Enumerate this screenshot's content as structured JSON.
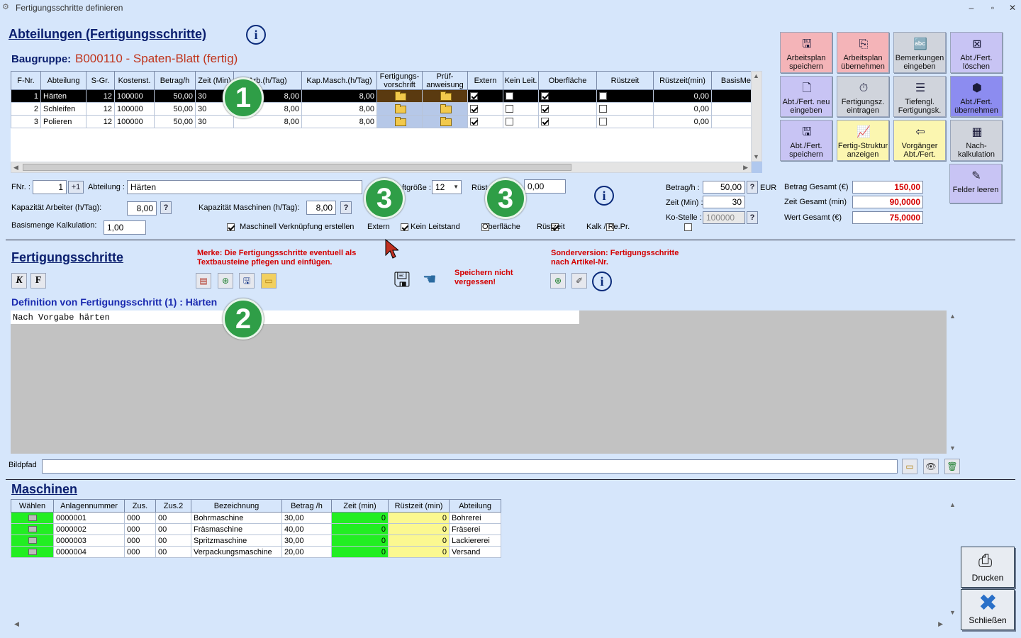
{
  "window": {
    "title": "Fertigungsschritte definieren",
    "min": "–",
    "max": "▫",
    "close": "✕"
  },
  "abteilungen": {
    "title": "Abteilungen (Fertigungsschritte) ",
    "baugruppe_label": "Baugruppe:",
    "baugruppe_value": "B000110 - Spaten-Blatt (fertig)"
  },
  "dept_table": {
    "headers": [
      "F-Nr.",
      "Abteilung",
      "S-Gr.",
      "Kostenst.",
      "Betrag/h",
      "Zeit (Min)",
      "Arb.(h/Tag)",
      "Kap.Masch.(h/Tag)",
      "Fertigungs-vorschrift",
      "Prüf-anweisung",
      "Extern",
      "Kein Leit.",
      "Oberfläche",
      "Rüstzeit",
      "Rüstzeit(min)",
      "BasisMe."
    ],
    "rows": [
      {
        "nr": "1",
        "abteilung": "Härten",
        "sgr": "12",
        "kst": "100000",
        "betrag": "50,00",
        "zeit": "30",
        "arb": "8,00",
        "kap": "8,00",
        "extern": true,
        "keinleit": false,
        "oberflaeche": true,
        "ruestzeit": false,
        "ruestmin": "0,00"
      },
      {
        "nr": "2",
        "abteilung": "Schleifen",
        "sgr": "12",
        "kst": "100000",
        "betrag": "50,00",
        "zeit": "30",
        "arb": "8,00",
        "kap": "8,00",
        "extern": true,
        "keinleit": false,
        "oberflaeche": true,
        "ruestzeit": false,
        "ruestmin": "0,00"
      },
      {
        "nr": "3",
        "abteilung": "Polieren",
        "sgr": "12",
        "kst": "100000",
        "betrag": "50,00",
        "zeit": "30",
        "arb": "8,00",
        "kap": "8,00",
        "extern": true,
        "keinleit": false,
        "oberflaeche": true,
        "ruestzeit": false,
        "ruestmin": "0,00"
      }
    ]
  },
  "form": {
    "fnr_label": "FNr. :",
    "fnr_value": "1",
    "plus1": "+1",
    "abteilung_label": "Abteilung :",
    "abteilung_value": "Härten",
    "losgroesse_label": "ftgröße :",
    "losgroesse_value": "12",
    "ruest_label": "Rüst",
    "ruest_value": "0,00",
    "kap_arb_label": "Kapazität Arbeiter (h/Tag):",
    "kap_arb_value": "8,00",
    "kap_masch_label": "Kapazität Maschinen (h/Tag):",
    "kap_masch_value": "8,00",
    "basis_label": "Basismenge Kalkulation:",
    "basis_value": "1,00",
    "maschinell_label": "Maschinell Verknüpfung erstellen",
    "extern_label": "Extern",
    "keinleit_label": "Kein Leitstand",
    "oberflaeche_label": "Oberfläche",
    "ruestzeit_label": "Rüstzeit",
    "kalk_label": "Kalk / Re.Pr.",
    "q": "?",
    "betrag_label": "Betrag/h :",
    "betrag_value": "50,00",
    "eur": "EUR",
    "zeit_label": "Zeit (Min) :",
    "zeit_value": "30",
    "kostelle_label": "Ko-Stelle :",
    "kostelle_value": "100000",
    "betrag_gesamt_label": "Betrag Gesamt (€)",
    "betrag_gesamt_value": "150,00",
    "zeit_gesamt_label": "Zeit Gesamt (min)",
    "zeit_gesamt_value": "90,0000",
    "wert_gesamt_label": "Wert Gesamt (€)",
    "wert_gesamt_value": "75,0000"
  },
  "toolbar": [
    {
      "label": "Arbeitsplan speichern",
      "icon": "save-icon",
      "glyph": "🖫",
      "color": "#f4b4b8"
    },
    {
      "label": "Arbeitsplan übernehmen",
      "icon": "copy-doc-icon",
      "glyph": "⎘",
      "color": "#f4b4b8"
    },
    {
      "label": "Bemerkungen eingeben",
      "icon": "az-icon",
      "glyph": "🔤",
      "color": "#d0d4dc"
    },
    {
      "label": "Abt./Fert. löschen",
      "icon": "delete-box-icon",
      "glyph": "⊠",
      "color": "#c8c4f4"
    },
    {
      "label": "Abt./Fert. neu eingeben",
      "icon": "new-doc-icon",
      "glyph": "🗋",
      "color": "#c8c4f4"
    },
    {
      "label": "Fertigungsz. eintragen",
      "icon": "stopwatch-icon",
      "glyph": "⏱",
      "color": "#d0d4dc"
    },
    {
      "label": "Tiefengl. Fertigungsk.",
      "icon": "list-doc-icon",
      "glyph": "☰",
      "color": "#d0d4dc"
    },
    {
      "label": "Abt./Fert. übernehmen",
      "icon": "box-icon",
      "glyph": "⬢",
      "color": "#8c8cf0"
    },
    {
      "label": "Abt./Fert. speichern",
      "icon": "save-icon",
      "glyph": "🖫",
      "color": "#c8c4f4"
    },
    {
      "label": "Fertig-Struktur anzeigen",
      "icon": "chart-line-icon",
      "glyph": "📈",
      "color": "#fbf6b0"
    },
    {
      "label": "Vorgänger Abt./Fert.",
      "icon": "back-arrow-icon",
      "glyph": "⇦",
      "color": "#fbf6b0"
    },
    {
      "label": "Nach-kalkulation",
      "icon": "calculator-icon",
      "glyph": "▦",
      "color": "#d0d4dc"
    }
  ],
  "felder_leeren": "Felder leeren",
  "fertigungsschritte": {
    "title": "Fertigungsschritte",
    "merke": "Merke: Die Fertigungsschritte eventuell als Textbausteine pflegen und einfügen.",
    "speichern": "Speichern nicht vergessen!",
    "sonder": "Sonderversion: Fertigungsschritte nach Artikel-Nr.",
    "k": "K",
    "f": "F",
    "definition": "Definition von Fertigungsschritt (1) : Härten",
    "text": "Nach Vorgabe härten",
    "bildpfad_label": "Bildpfad",
    "bildpfad_value": ""
  },
  "callouts": [
    "1",
    "2",
    "3",
    "3"
  ],
  "maschinen": {
    "title": "Maschinen",
    "headers": [
      "Wählen",
      "Anlagennummer",
      "Zus.",
      "Zus.2",
      "Bezeichnung",
      "Betrag /h",
      "Zeit (min)",
      "Rüstzeit (min)",
      "Abteilung"
    ],
    "rows": [
      {
        "nr": "0000001",
        "zus": "000",
        "zus2": "00",
        "bez": "Bohrmaschine",
        "betrag": "30,00",
        "zeit": "0",
        "ruest": "0",
        "abt": "Bohrerei"
      },
      {
        "nr": "0000002",
        "zus": "000",
        "zus2": "00",
        "bez": "Fräsmaschine",
        "betrag": "40,00",
        "zeit": "0",
        "ruest": "0",
        "abt": "Fräserei"
      },
      {
        "nr": "0000003",
        "zus": "000",
        "zus2": "00",
        "bez": "Spritzmaschine",
        "betrag": "30,00",
        "zeit": "0",
        "ruest": "0",
        "abt": "Lackiererei"
      },
      {
        "nr": "0000004",
        "zus": "000",
        "zus2": "00",
        "bez": "Verpackungsmaschine",
        "betrag": "20,00",
        "zeit": "0",
        "ruest": "0",
        "abt": "Versand"
      }
    ]
  },
  "drucken": "Drucken",
  "schliessen": "Schließen"
}
